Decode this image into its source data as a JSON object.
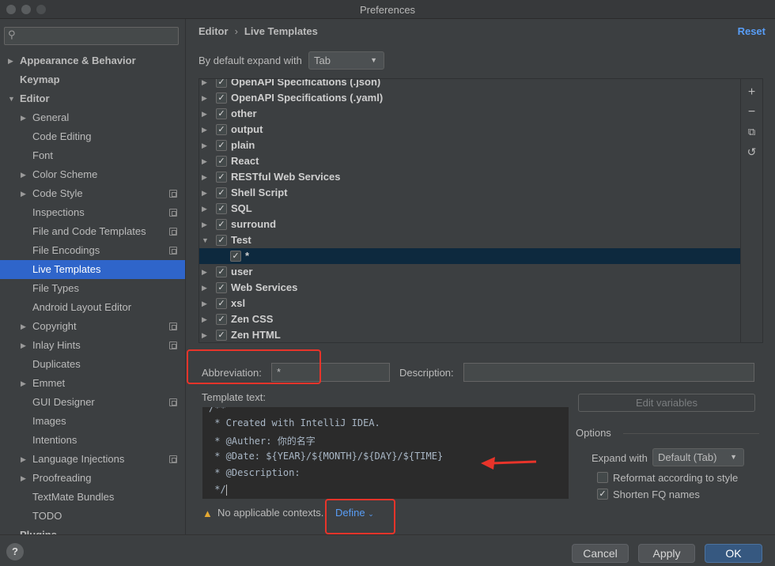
{
  "window": {
    "title": "Preferences"
  },
  "search": {
    "placeholder": ""
  },
  "sidebar": {
    "items": [
      {
        "label": "Appearance & Behavior"
      },
      {
        "label": "Keymap"
      },
      {
        "label": "Editor"
      },
      {
        "label": "General"
      },
      {
        "label": "Code Editing"
      },
      {
        "label": "Font"
      },
      {
        "label": "Color Scheme"
      },
      {
        "label": "Code Style"
      },
      {
        "label": "Inspections"
      },
      {
        "label": "File and Code Templates"
      },
      {
        "label": "File Encodings"
      },
      {
        "label": "Live Templates"
      },
      {
        "label": "File Types"
      },
      {
        "label": "Android Layout Editor"
      },
      {
        "label": "Copyright"
      },
      {
        "label": "Inlay Hints"
      },
      {
        "label": "Duplicates"
      },
      {
        "label": "Emmet"
      },
      {
        "label": "GUI Designer"
      },
      {
        "label": "Images"
      },
      {
        "label": "Intentions"
      },
      {
        "label": "Language Injections"
      },
      {
        "label": "Proofreading"
      },
      {
        "label": "TextMate Bundles"
      },
      {
        "label": "TODO"
      },
      {
        "label": "Plugins"
      }
    ]
  },
  "breadcrumb": {
    "parent": "Editor",
    "separator": "›",
    "current": "Live Templates"
  },
  "reset_label": "Reset",
  "expand": {
    "label": "By default expand with",
    "value": "Tab"
  },
  "templates": {
    "groups": [
      {
        "label": "OpenAPI Specifications (.json)"
      },
      {
        "label": "OpenAPI Specifications (.yaml)"
      },
      {
        "label": "other"
      },
      {
        "label": "output"
      },
      {
        "label": "plain"
      },
      {
        "label": "React"
      },
      {
        "label": "RESTful Web Services"
      },
      {
        "label": "Shell Script"
      },
      {
        "label": "SQL"
      },
      {
        "label": "surround"
      },
      {
        "label": "Test"
      },
      {
        "label": "*"
      },
      {
        "label": "user"
      },
      {
        "label": "Web Services"
      },
      {
        "label": "xsl"
      },
      {
        "label": "Zen CSS"
      },
      {
        "label": "Zen HTML"
      }
    ]
  },
  "toolbar": {
    "add": "+",
    "remove": "−",
    "copy": "⧉",
    "restore": "↺"
  },
  "abbreviation": {
    "label": "Abbreviation:",
    "value": "*"
  },
  "description": {
    "label": "Description:",
    "value": ""
  },
  "template_text": {
    "label": "Template text:",
    "lines": [
      "/**",
      " * Created with IntelliJ IDEA.",
      " * @Auther: 你的名字",
      " * @Date: ${YEAR}/${MONTH}/${DAY}/${TIME}",
      " * @Description:",
      " */"
    ]
  },
  "edit_variables_label": "Edit variables",
  "options": {
    "label": "Options",
    "expand_label": "Expand with",
    "expand_value": "Default (Tab)",
    "reformat_label": "Reformat according to style",
    "reformat_checked": false,
    "shorten_label": "Shorten FQ names",
    "shorten_checked": true
  },
  "contexts": {
    "warning": "No applicable contexts.",
    "define_label": "Define"
  },
  "buttons": {
    "help": "?",
    "cancel": "Cancel",
    "apply": "Apply",
    "ok": "OK"
  },
  "colors": {
    "accent": "#2f65ca",
    "link": "#589df6",
    "annotation": "#e8342a",
    "warning": "#e3a832"
  }
}
